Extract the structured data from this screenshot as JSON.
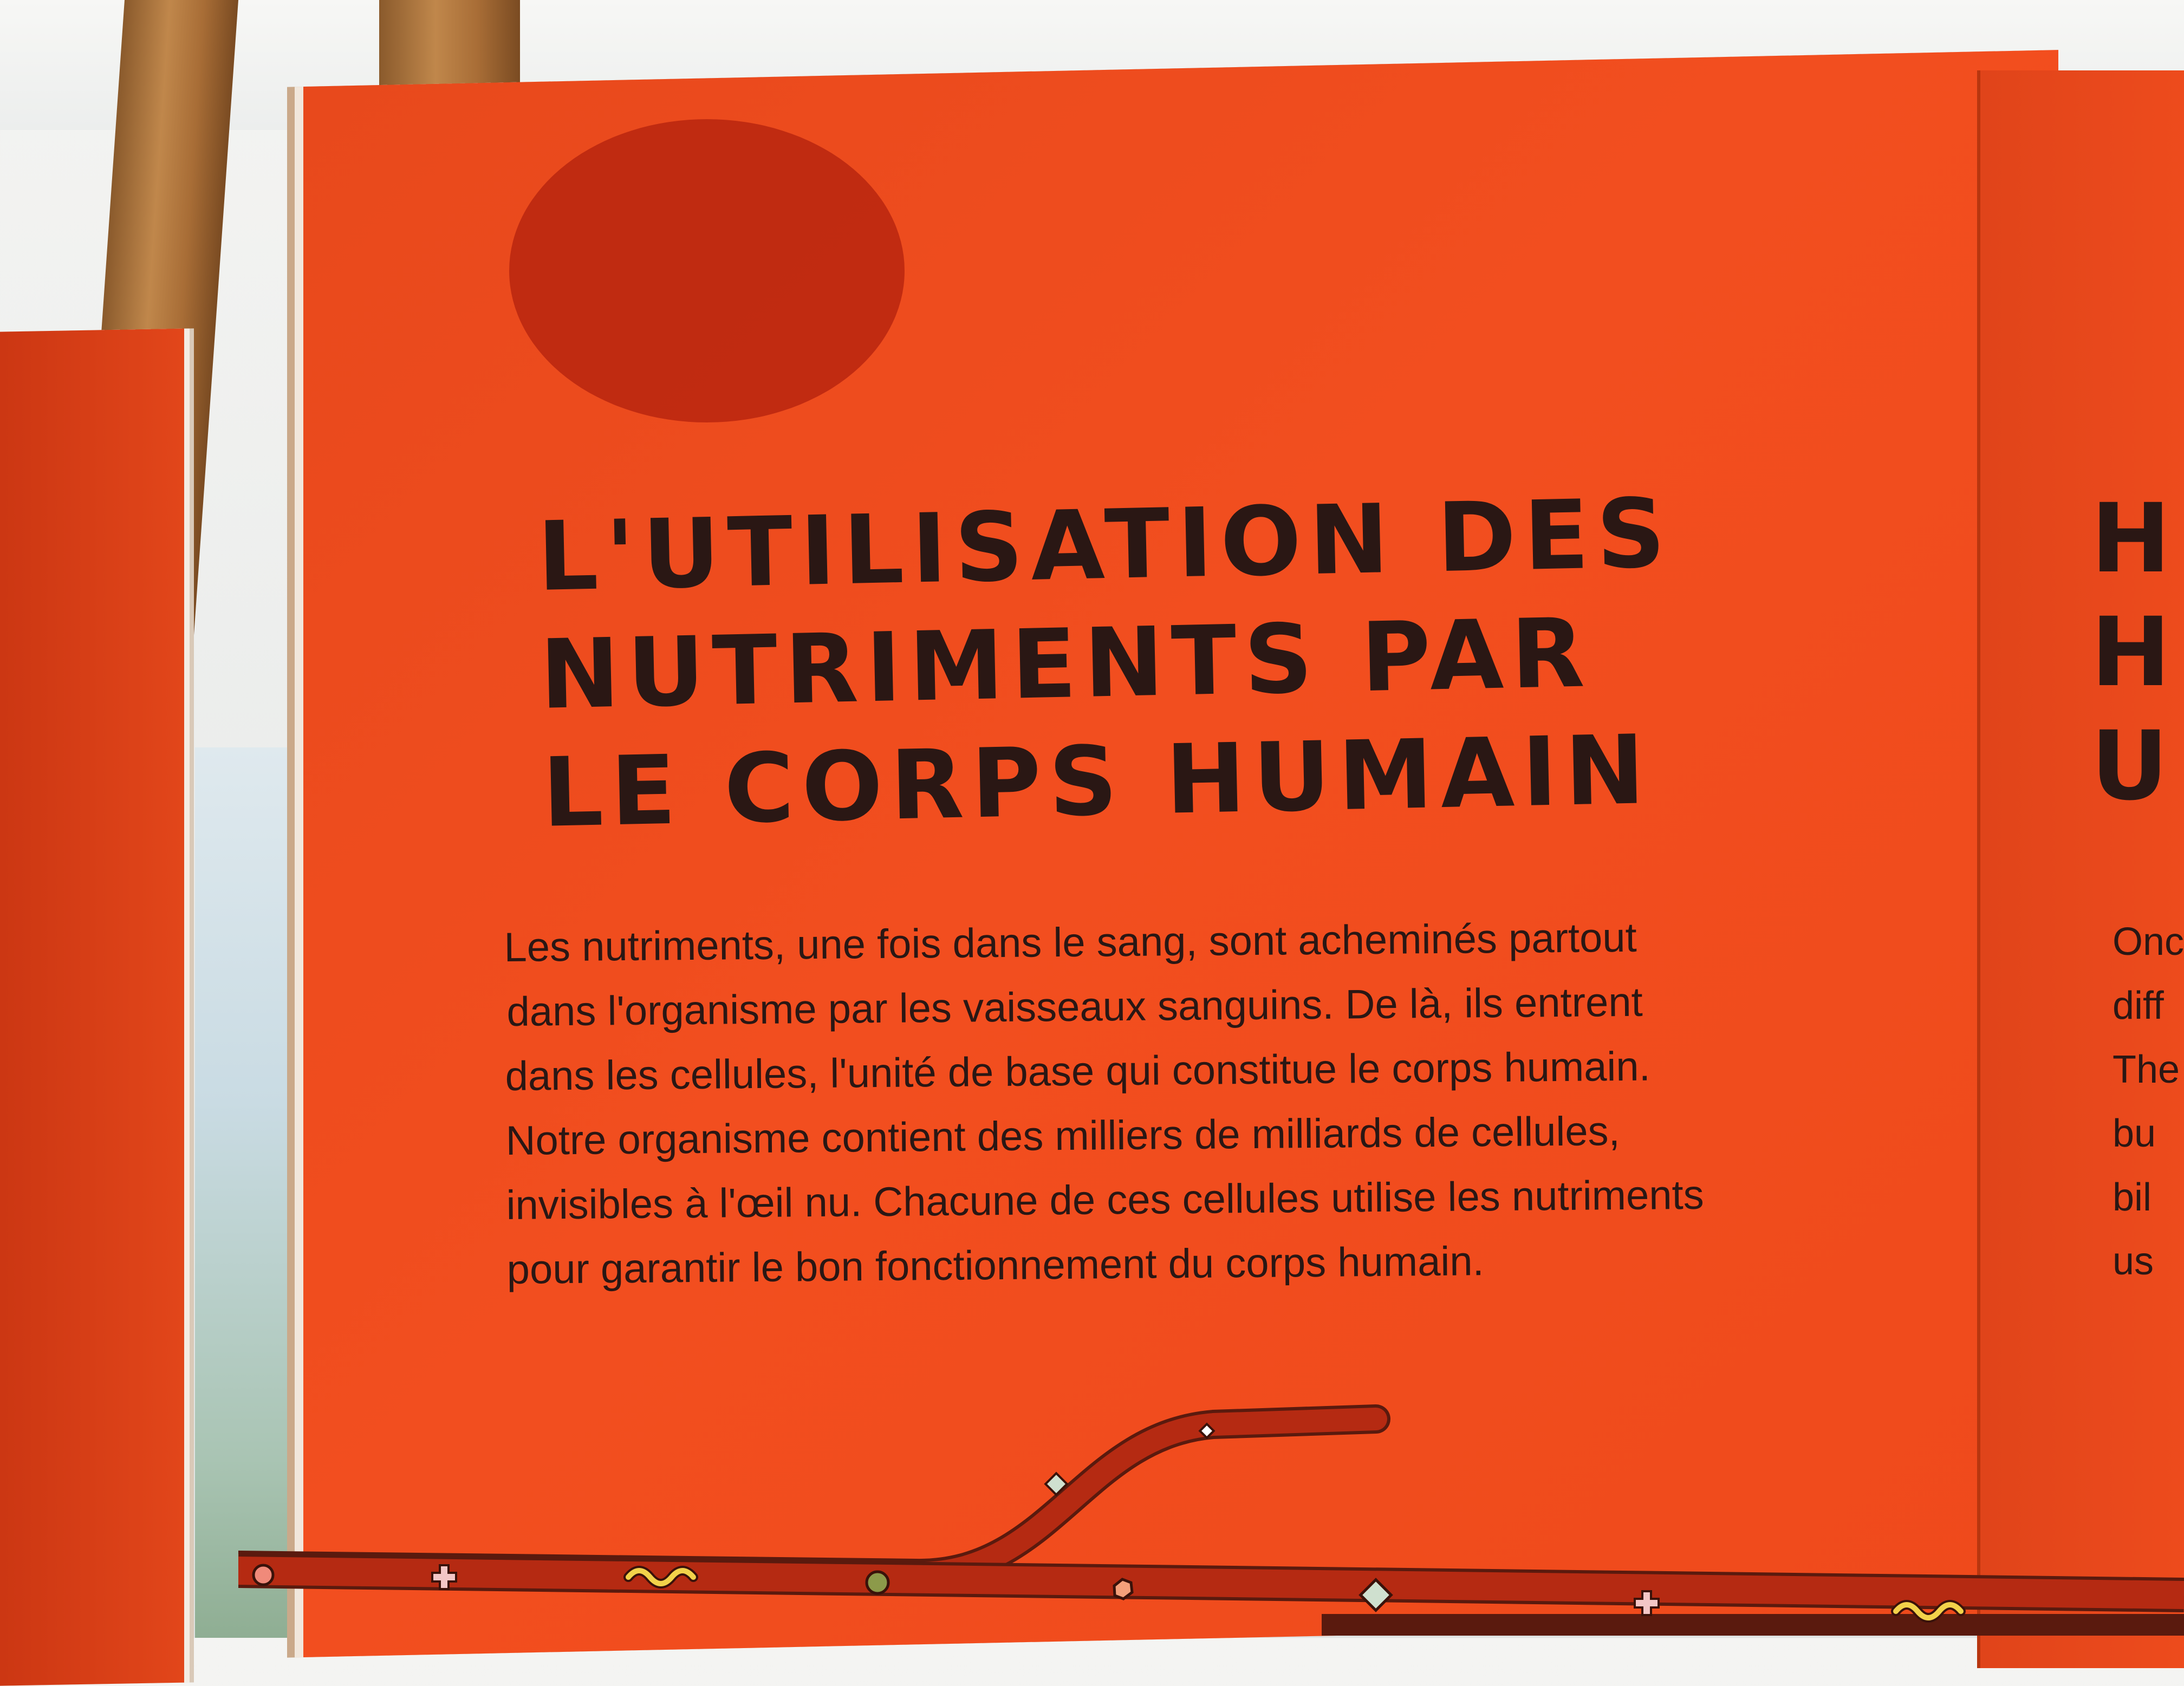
{
  "panel": {
    "title_lines": [
      "L'UTILISATION DES",
      "NUTRIMENTS PAR",
      "LE CORPS HUMAIN"
    ],
    "paragraph_lines": [
      "Les nutriments, une fois dans le sang, sont acheminés partout",
      "dans l'organisme par les vaisseaux sanguins. De là, ils entrent",
      "dans les cellules, l'unité de base qui constitue le corps humain.",
      "Notre organisme contient des milliers de milliards de cellules,",
      "invisibles à l'œil nu. Chacune de ces cellules utilise les nutriments",
      "pour garantir le bon fonctionnement du corps humain."
    ]
  },
  "adjacent_panel": {
    "title_fragments": [
      "H",
      "H",
      "U"
    ],
    "text_fragments": [
      "Onc",
      "diff",
      "The",
      "bu",
      "bil",
      "us"
    ]
  },
  "colors": {
    "panel_orange": "#ef4a1b",
    "circle_red": "#b8260f",
    "vessel_red": "#b52a12",
    "text_dark": "#2a1714"
  },
  "icons": [
    "blood-vessel-illustration",
    "nutrient-dot-icon",
    "nutrient-cross-icon",
    "nutrient-squiggle-icon",
    "nutrient-diamond-icon",
    "nutrient-hexagon-icon"
  ]
}
